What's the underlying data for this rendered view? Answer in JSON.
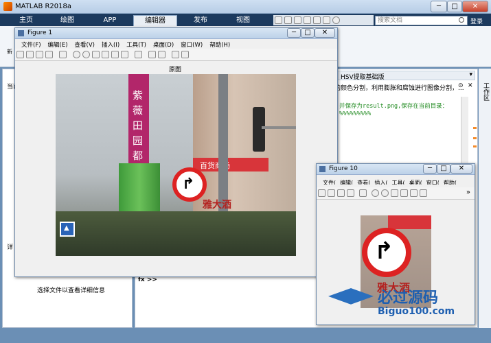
{
  "app": {
    "title": "MATLAB R2018a",
    "icon": "matlab-logo-icon"
  },
  "tabs": [
    "主页",
    "绘图",
    "APP",
    "编辑器",
    "发布",
    "视图"
  ],
  "active_tab": "编辑器",
  "search": {
    "placeholder": "搜索文档"
  },
  "login": "登录",
  "left": {
    "label_1": "当前",
    "label_2": "详",
    "details_hint": "选择文件以查看详细信息"
  },
  "editor": {
    "doc_title": "HSV提取基础版",
    "comment": "的颜色分割，利用膨胀和腐蚀进行图像分割，...",
    "code_line": "并保存为result.png,保存在当前目录：",
    "percent": "%%%%%%%%%",
    "prompt": "fx >>"
  },
  "workspace_label": "工作区",
  "fig1": {
    "title": "Figure 1",
    "menu": [
      "文件(F)",
      "编辑(E)",
      "查看(V)",
      "插入(I)",
      "工具(T)",
      "桌面(D)",
      "窗口(W)",
      "帮助(H)"
    ],
    "axes_title": "原图"
  },
  "fig10": {
    "title": "Figure 10",
    "menu": [
      "文件(",
      "编辑(",
      "查看(",
      "插入(",
      "工具(",
      "桌面(",
      "窗口(",
      "帮助("
    ],
    "toolbar_more": "»"
  },
  "photo": {
    "banner_text": "紫薇田园都",
    "sign_text": "雅大酒",
    "shop_text": "百货商场"
  },
  "watermark": {
    "line1": "必过源码",
    "line2": "Biguo100.com"
  }
}
